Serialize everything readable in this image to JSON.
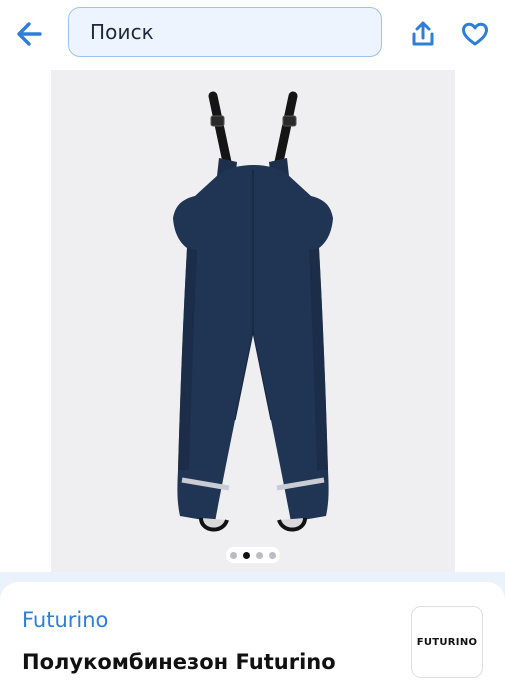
{
  "header": {
    "back_icon": "arrow-left-icon",
    "search": {
      "value": "Поиск"
    },
    "share_icon": "share-upload-icon",
    "favorite_icon": "heart-outline-icon"
  },
  "colors": {
    "accent": "#2e7ed8",
    "search_bg": "#edf4fd",
    "search_border": "#9cc2ef",
    "gallery_bg": "#efeff1",
    "product_navy": "#203453"
  },
  "gallery": {
    "image_count": 4,
    "active_index": 1,
    "dots": [
      {
        "active": false
      },
      {
        "active": true
      },
      {
        "active": false
      },
      {
        "active": false
      }
    ]
  },
  "product": {
    "brand": "Futurino",
    "title": "Полукомбинезон Futurino",
    "brand_logo_text": "FUTURINO"
  }
}
